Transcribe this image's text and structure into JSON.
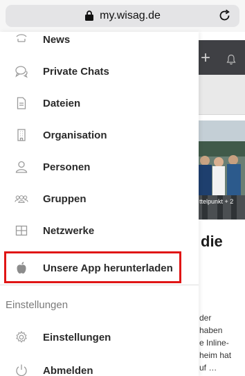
{
  "browser": {
    "url": "my.wisag.de"
  },
  "background_page": {
    "photo_label": "ttelpunkt + 2",
    "heading": "die",
    "snippet_lines": [
      "der",
      "haben",
      "e Inline-",
      "heim hat",
      "uf …"
    ]
  },
  "menu": {
    "items": [
      {
        "label": "News",
        "icon": "news-icon"
      },
      {
        "label": "Private Chats",
        "icon": "chat-bubbles-icon"
      },
      {
        "label": "Dateien",
        "icon": "file-icon"
      },
      {
        "label": "Organisation",
        "icon": "building-icon"
      },
      {
        "label": "Personen",
        "icon": "person-icon"
      },
      {
        "label": "Gruppen",
        "icon": "group-icon"
      },
      {
        "label": "Netzwerke",
        "icon": "grid-icon"
      },
      {
        "label": "Unsere App herunterladen",
        "icon": "apple-icon"
      }
    ],
    "section_heading": "Einstellungen",
    "settings_items": [
      {
        "label": "Einstellungen",
        "icon": "gear-icon"
      },
      {
        "label": "Abmelden",
        "icon": "power-icon"
      }
    ]
  },
  "highlight_color": "#e01515"
}
